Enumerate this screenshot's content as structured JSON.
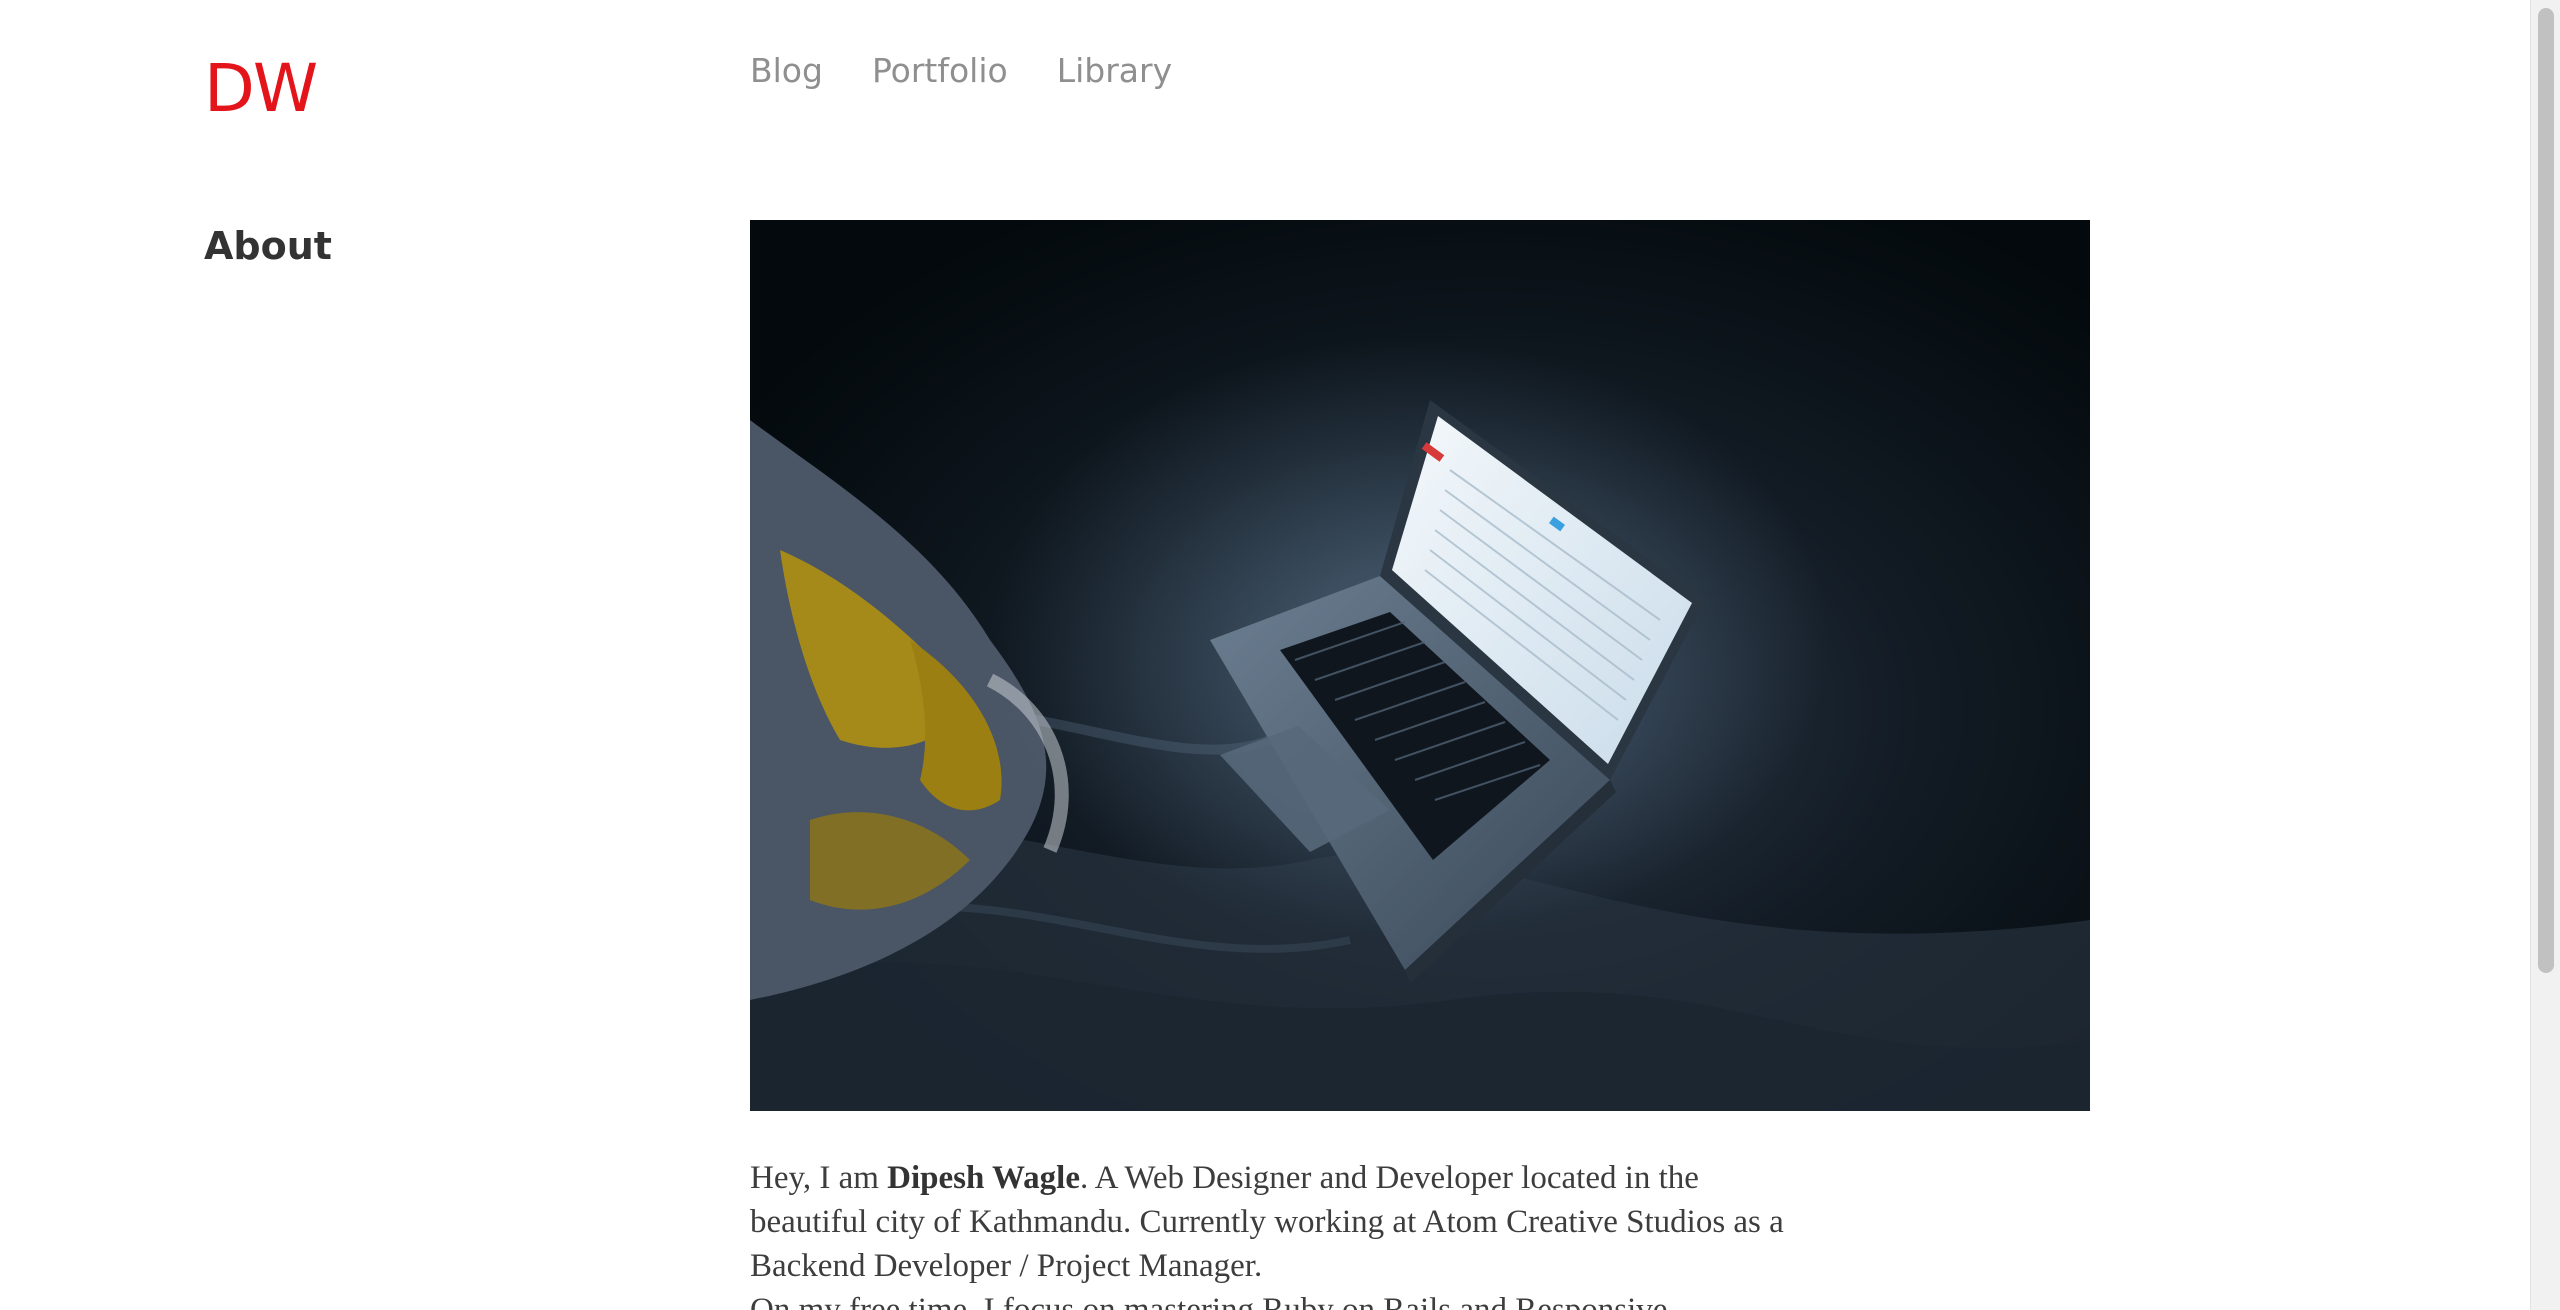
{
  "header": {
    "logo_text": "DW",
    "nav": [
      {
        "label": "Blog"
      },
      {
        "label": "Portfolio"
      },
      {
        "label": "Library"
      }
    ]
  },
  "page": {
    "heading": "About"
  },
  "intro": {
    "lead": "Hey, I am ",
    "name": "Dipesh Wagle",
    "rest": ". A Web Designer and Developer located in the beautiful city of Kathmandu. Currently working at Atom Creative Studios as a Backend Developer / Project Manager.",
    "second_line": "On my free time, I focus on mastering Ruby on Rails and Responsive"
  },
  "colors": {
    "accent": "#e4141b",
    "nav_text": "#8f8f8f",
    "body_text": "#3d3d3d",
    "heading_text": "#333333"
  }
}
